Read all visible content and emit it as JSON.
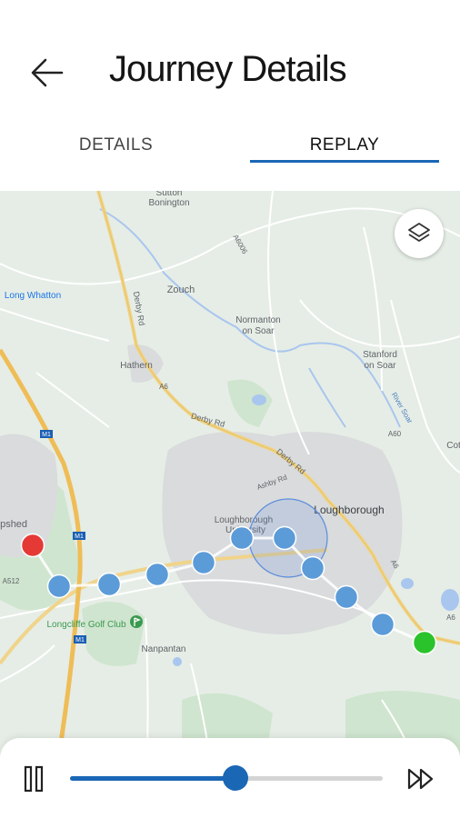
{
  "header": {
    "title": "Journey Details"
  },
  "tabs": [
    {
      "label": "DETAILS",
      "selected": false
    },
    {
      "label": "REPLAY",
      "selected": true
    }
  ],
  "map": {
    "places": [
      {
        "name": "Sutton\nBonington",
        "kind": "village"
      },
      {
        "name": "Zouch",
        "kind": "village"
      },
      {
        "name": "Long Whatton",
        "kind": "village-link"
      },
      {
        "name": "Normanton\non Soar",
        "kind": "village"
      },
      {
        "name": "Hathern",
        "kind": "village"
      },
      {
        "name": "Stanford\non Soar",
        "kind": "village"
      },
      {
        "name": "Loughborough",
        "kind": "town"
      },
      {
        "name": "Loughborough\nUniversity",
        "kind": "poi"
      },
      {
        "name": "epshed",
        "kind": "village"
      },
      {
        "name": "Longcliffe Golf Club",
        "kind": "poi-green"
      },
      {
        "name": "Nanpantan",
        "kind": "village"
      },
      {
        "name": "Cot",
        "kind": "village"
      }
    ],
    "road_labels": [
      "Derby Rd",
      "A6",
      "M1",
      "A512",
      "Ashby Rd",
      "A60",
      "River Soar",
      "A6006"
    ],
    "route": {
      "start_color": "#e53935",
      "end_color": "#2bc32b",
      "waypoint_color": "#5b9bd8"
    }
  },
  "controls": {
    "pause_icon": "pause-icon",
    "fast_forward_icon": "fast-forward-icon",
    "progress": 0.53,
    "accent_color": "#1a67b5"
  }
}
